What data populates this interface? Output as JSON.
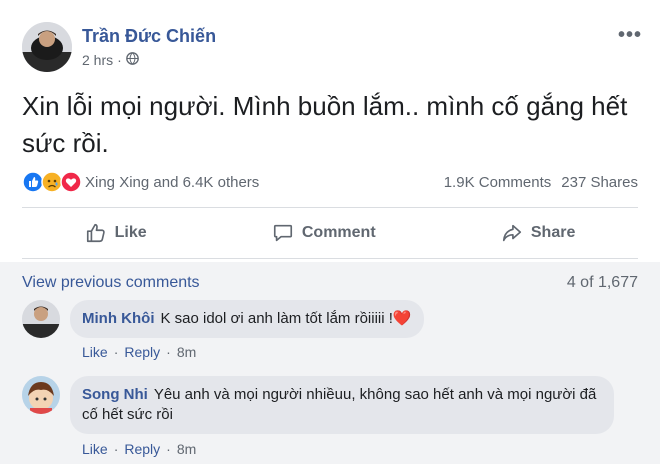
{
  "post": {
    "author": "Trần Đức Chiến",
    "time": "2 hrs",
    "privacy_icon": "globe-icon",
    "more_label": "•••",
    "text": "Xin lỗi mọi người. Mình buồn lắm.. mình cố gắng hết sức rồi.",
    "reactions": {
      "icons": [
        "like-reaction-icon",
        "sad-reaction-icon",
        "love-reaction-icon"
      ],
      "summary": "Xing Xing and 6.4K others",
      "comments": "1.9K Comments",
      "shares": "237 Shares"
    },
    "actions": {
      "like": "Like",
      "comment": "Comment",
      "share": "Share"
    }
  },
  "comments": {
    "view_previous": "View previous comments",
    "count": "4 of 1,677",
    "items": [
      {
        "name": "Minh Khôi",
        "text": "K sao idol ơi anh làm tốt lắm rồiiiii !",
        "emoji": "❤️",
        "like": "Like",
        "reply": "Reply",
        "separator": "·",
        "time": "8m"
      },
      {
        "name": "Song Nhi",
        "text": "Yêu anh và mọi người nhiềuu, không sao hết anh và mọi người đã cố hết sức rồi",
        "like": "Like",
        "reply": "Reply",
        "separator": "·",
        "time": "8m"
      }
    ]
  },
  "colors": {
    "link": "#385898",
    "secondary_text": "#606770",
    "like_blue": "#1877f2",
    "love_red": "#f02849",
    "sad_yellow": "#f7b125"
  }
}
